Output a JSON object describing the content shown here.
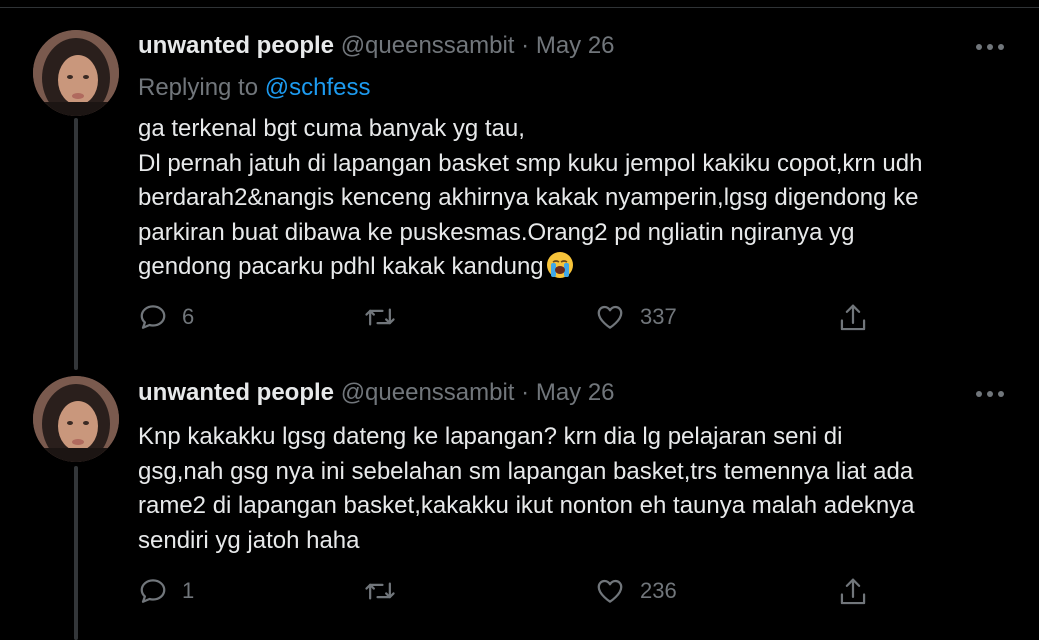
{
  "tweets": [
    {
      "display_name": "unwanted people",
      "handle": "@queenssambit",
      "separator": "·",
      "date": "May 26",
      "replying_prefix": "Replying to",
      "replying_to": "@schfess",
      "text_lines": [
        "ga terkenal bgt cuma banyak yg tau,",
        "Dl pernah jatuh di lapangan basket smp kuku jempol kakiku copot,krn udh",
        "berdarah2&nangis kenceng akhirnya kakak nyamperin,lgsg digendong ke",
        "parkiran buat dibawa ke puskesmas.Orang2 pd ngliatin ngiranya yg",
        "gendong pacarku pdhl kakak kandung"
      ],
      "emoji": "loudly-crying-face",
      "reply_count": "6",
      "retweet_count": "",
      "like_count": "337"
    },
    {
      "display_name": "unwanted people",
      "handle": "@queenssambit",
      "separator": "·",
      "date": "May 26",
      "text_lines": [
        "Knp kakakku lgsg dateng ke lapangan? krn dia lg pelajaran seni di",
        "gsg,nah gsg nya ini sebelahan sm lapangan basket,trs temennya liat ada",
        "rame2 di lapangan basket,kakakku ikut nonton eh taunya malah adeknya",
        "sendiri yg jatoh haha"
      ],
      "reply_count": "1",
      "retweet_count": "",
      "like_count": "236"
    }
  ],
  "colors": {
    "background": "#000000",
    "text": "#e7e9ea",
    "muted": "#71767b",
    "mention": "#1d9bf0",
    "thread_line": "#333639"
  },
  "icons": [
    "more-icon",
    "reply-icon",
    "retweet-icon",
    "like-icon",
    "share-icon"
  ]
}
